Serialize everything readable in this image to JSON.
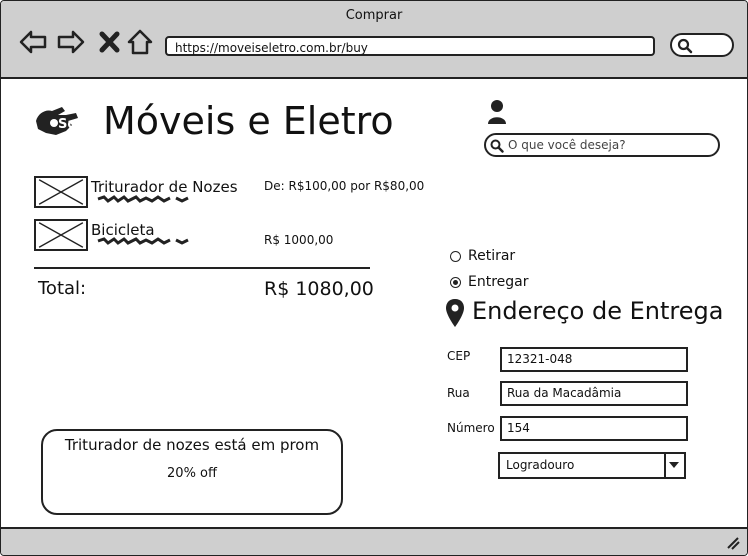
{
  "browser": {
    "title": "Comprar",
    "url": "https://moveiseletro.com.br/buy"
  },
  "site": {
    "name": "Móveis e Eletro",
    "search_placeholder": "O que você deseja?"
  },
  "cart": {
    "items": [
      {
        "name": "Triturador de Nozes",
        "price": "De: R$100,00 por R$80,00"
      },
      {
        "name": "Bicicleta",
        "price": "R$ 1000,00"
      }
    ],
    "total_label": "Total:",
    "total_value": "R$ 1080,00"
  },
  "promo": {
    "line1": "Triturador de nozes está em prom",
    "line2": "20% off"
  },
  "shipping": {
    "options": [
      {
        "label": "Retirar",
        "selected": false
      },
      {
        "label": "Entregar",
        "selected": true
      }
    ],
    "title": "Endereço de Entrega",
    "fields": {
      "cep_label": "CEP",
      "cep_value": "12321-048",
      "rua_label": "Rua",
      "rua_value": "Rua da Macadâmia",
      "numero_label": "Número",
      "numero_value": "154"
    },
    "select_value": "Logradouro"
  }
}
